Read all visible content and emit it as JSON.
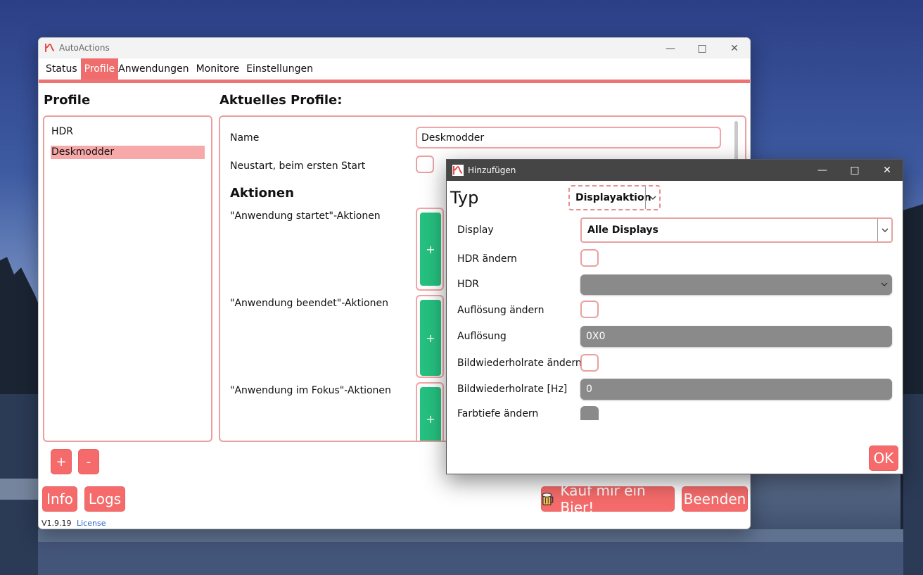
{
  "main_window": {
    "title": "AutoActions",
    "menu": [
      "Status",
      "Profile",
      "Anwendungen",
      "Monitore",
      "Einstellungen"
    ],
    "active_menu": "Profile",
    "profiles_title": "Profile",
    "profiles": [
      "HDR",
      "Deskmodder"
    ],
    "selected_profile": "Deskmodder",
    "add_profile": "+",
    "remove_profile": "-",
    "current_profile_title": "Aktuelles Profile:",
    "name_label": "Name",
    "name_value": "Deskmodder",
    "restart_label": "Neustart, beim ersten Start",
    "actions_title": "Aktionen",
    "action_groups": [
      "\"Anwendung startet\"-Aktionen",
      "\"Anwendung beendet\"-Aktionen",
      "\"Anwendung im Fokus\"-Aktionen"
    ],
    "add_action": "+",
    "info_button": "Info",
    "logs_button": "Logs",
    "beer_button": "Kauf mir ein Bier!",
    "exit_button": "Beenden",
    "version": "V1.9.19",
    "license_link": "License"
  },
  "dialog": {
    "title": "Hinzufügen",
    "type_label": "Typ",
    "type_value": "Displayaktion",
    "display_label": "Display",
    "display_value": "Alle Displays",
    "hdr_change_label": "HDR ändern",
    "hdr_label": "HDR",
    "resolution_change_label": "Auflösung ändern",
    "resolution_label": "Auflösung",
    "resolution_value": "0X0",
    "refresh_change_label": "Bildwiederholrate ändern",
    "refresh_label": "Bildwiederholrate [Hz]",
    "refresh_value": "0",
    "color_depth_change_label": "Farbtiefe ändern",
    "ok_button": "OK"
  },
  "icons": {
    "app": "autoactions-logo-icon",
    "beer": "beer-mug-icon",
    "chevron": "chevron-down-icon"
  },
  "colors": {
    "accent": "#f06d6d",
    "panel_border": "#eaa0a0",
    "selection": "#f7a9a9",
    "green": "#25c180",
    "disabled_field": "#8a8a8a"
  }
}
